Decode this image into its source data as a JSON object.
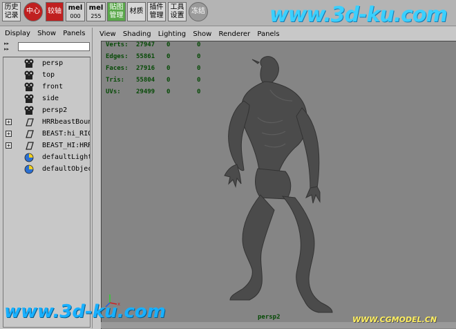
{
  "shelf": {
    "buttons": [
      {
        "label": "历史\n记录",
        "style": "lgray"
      },
      {
        "label": "中心",
        "style": "red"
      },
      {
        "label": "较轴",
        "style": "red"
      },
      {
        "label": "mel",
        "sub": "000",
        "style": "mel"
      },
      {
        "label": "mel",
        "sub": "255",
        "style": "mel"
      },
      {
        "label": "贴图\n管理",
        "style": "green"
      },
      {
        "label": "材质",
        "style": "lgray"
      },
      {
        "label": "插件\n管理",
        "style": "lgray"
      },
      {
        "label": "工具\n设置",
        "style": "lgray"
      },
      {
        "label": "冻结",
        "style": "gray"
      }
    ],
    "brand": "www.3d-ku.com"
  },
  "outliner": {
    "menu": [
      "Display",
      "Show",
      "Panels"
    ],
    "filter_value": "",
    "items": [
      {
        "label": "persp",
        "icon": "camera-icon",
        "expandable": false
      },
      {
        "label": "top",
        "icon": "camera-icon",
        "expandable": false
      },
      {
        "label": "front",
        "icon": "camera-icon",
        "expandable": false
      },
      {
        "label": "side",
        "icon": "camera-icon",
        "expandable": false
      },
      {
        "label": "persp2",
        "icon": "camera-icon",
        "expandable": false
      },
      {
        "label": "HRRbeastBound",
        "icon": "transform-icon",
        "expandable": true
      },
      {
        "label": "BEAST:hi_RIG",
        "icon": "transform-icon",
        "expandable": true
      },
      {
        "label": "BEAST_HI:HRRI",
        "icon": "transform-icon",
        "expandable": true
      },
      {
        "label": "defaultLightS",
        "icon": "set-icon",
        "expandable": false
      },
      {
        "label": "defaultObject",
        "icon": "set-icon",
        "expandable": false
      }
    ]
  },
  "viewport": {
    "menu": [
      "View",
      "Shading",
      "Lighting",
      "Show",
      "Renderer",
      "Panels"
    ],
    "hud": [
      {
        "key": "Verts:",
        "a": "27947",
        "b": "0",
        "c": "0"
      },
      {
        "key": "Edges:",
        "a": "55861",
        "b": "0",
        "c": "0"
      },
      {
        "key": "Faces:",
        "a": "27916",
        "b": "0",
        "c": "0"
      },
      {
        "key": "Tris:",
        "a": "55804",
        "b": "0",
        "c": "0"
      },
      {
        "key": "UVs:",
        "a": "29499",
        "b": "0",
        "c": "0"
      }
    ],
    "camera": "persp2",
    "model_color": "#4a4a4a",
    "background": "#858585"
  },
  "watermarks": {
    "left": "www.3d-ku.com",
    "right": "WWW.CGMODEL.CN"
  }
}
